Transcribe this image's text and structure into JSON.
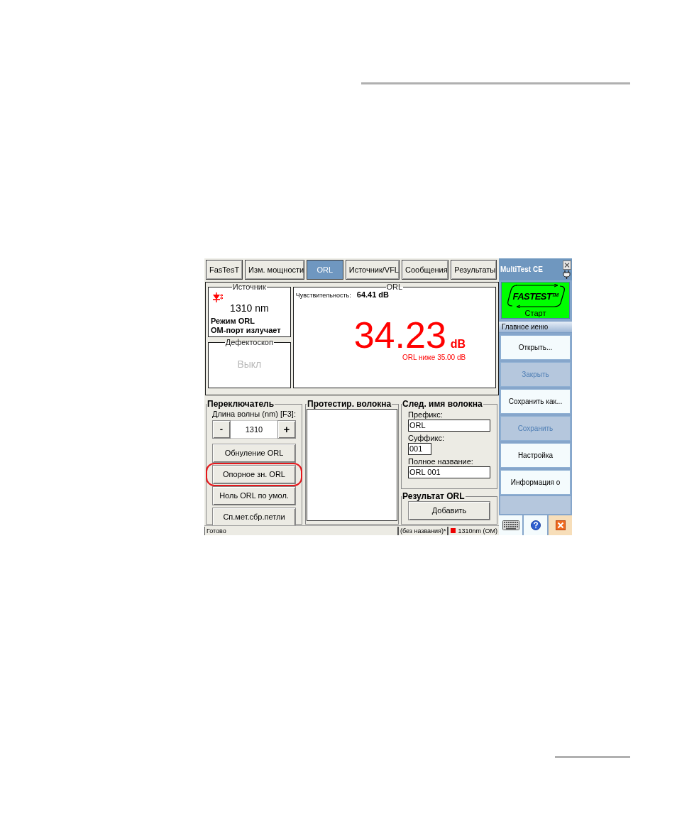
{
  "tabs": [
    {
      "label": "FasTesT",
      "selected": false
    },
    {
      "label": "Изм. мощности",
      "selected": false
    },
    {
      "label": "ORL",
      "selected": true
    },
    {
      "label": "Источник/VFL",
      "selected": false
    },
    {
      "label": "Сообщения",
      "selected": false
    },
    {
      "label": "Результаты",
      "selected": false
    }
  ],
  "source": {
    "title": "Источник",
    "wavelength": "1310 nm",
    "mode": "Режим ORL",
    "port_status": "ОМ-порт излучает"
  },
  "vfl": {
    "title": "Дефектоскоп",
    "status": "Выкл",
    "disabled": true
  },
  "orl": {
    "title": "ORL",
    "sensitivity_label": "Чувствительность:",
    "sensitivity_value": "64.41 dB",
    "value": "34.23",
    "unit": "dB",
    "warning": "ORL ниже 35.00 dB"
  },
  "switch_panel": {
    "title": "Переключатель",
    "wavelength_label": "Длина волны (nm) [F3]:",
    "decrement": "-",
    "wavelength": "1310",
    "increment": "+",
    "buttons": [
      {
        "label": "Обнуление ORL",
        "highlighted": false
      },
      {
        "label": "Опорное зн. ORL",
        "highlighted": true
      },
      {
        "label": "Ноль ORL по умол.",
        "highlighted": false
      },
      {
        "label": "Сп.мет.сбр.петли",
        "highlighted": false
      }
    ]
  },
  "tested_fibers": {
    "title": "Протестир. волокна"
  },
  "next_fiber_name": {
    "title": "След. имя волокна",
    "fields": [
      {
        "label": "Префикс:",
        "value": "ORL",
        "kind": "text"
      },
      {
        "label": "Суффикс:",
        "value": "001",
        "kind": "number"
      },
      {
        "label": "Полное название:",
        "value": "ORL 001",
        "kind": "text"
      }
    ]
  },
  "orl_result": {
    "title": "Результат ORL",
    "button": "Добавить"
  },
  "status_bar": {
    "message": "Готово",
    "file": "(без названия)*",
    "source": "1310nm (OM)"
  },
  "side_panel": {
    "title": "MultiTest CE",
    "start_button": {
      "logo": "FASTEST$^{TM}$",
      "label": "Старт"
    },
    "menu_title": "Главное иеню",
    "menu": [
      {
        "label": "Открыть...",
        "disabled": false
      },
      {
        "label": "Закрыть",
        "disabled": true
      },
      {
        "label": "Сохранить как...",
        "disabled": false
      },
      {
        "label": "Сохранить",
        "disabled": true
      },
      {
        "label": "Настройка",
        "disabled": false
      },
      {
        "label": "Информация о",
        "disabled": false
      }
    ]
  }
}
